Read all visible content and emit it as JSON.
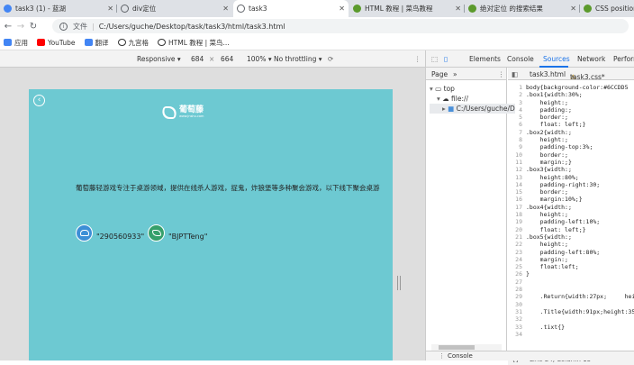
{
  "tabs": [
    {
      "title": "task3 (1) - 蓝湖",
      "color": "#4285f4"
    },
    {
      "title": "div定位",
      "color": "#5f6368"
    },
    {
      "title": "task3",
      "color": "#5f6368"
    },
    {
      "title": "HTML 教程 | 菜鸟教程",
      "color": "#5b9a2c"
    },
    {
      "title": "绝对定位 的搜索结果",
      "color": "#5b9a2c"
    },
    {
      "title": "CSS position",
      "color": "#5b9a2c"
    }
  ],
  "address": {
    "label": "文件",
    "url": "C:/Users/guche/Desktop/task/task3/html/task3.html"
  },
  "bookmarks": [
    {
      "label": "应用",
      "color": "#4285f4"
    },
    {
      "label": "YouTube",
      "color": "#ff0000"
    },
    {
      "label": "翻译",
      "color": "#4285f4"
    },
    {
      "label": "九宫格",
      "color": "#333333"
    },
    {
      "label": "HTML 教程 | 菜鸟...",
      "color": "#5b9a2c"
    }
  ],
  "device_toolbar": {
    "device": "Responsive ▾",
    "width": "684",
    "times": "×",
    "height": "664",
    "zoom": "100% ▾",
    "throttle": "No throttling ▾"
  },
  "page": {
    "logo_name": "葡萄藤",
    "logo_sub": "www.jnshu.com",
    "intro": "葡萄藤轻游戏专注于桌游领域，提供在线杀人游戏，捉鬼，炸狼堡等多种聚会游戏，以下线下聚会桌游",
    "qq_value": "\"290560933\"",
    "wechat_value": "\"BJPTTeng\""
  },
  "devtools": {
    "tabs": [
      "Elements",
      "Console",
      "Sources",
      "Network",
      "Perform"
    ],
    "active_tab": "Sources",
    "nav_tab": "Page",
    "nav_more": "»",
    "tree": [
      "top",
      "file://",
      "C:/Users/guche/D"
    ],
    "files": [
      "task3.html",
      "task3.css*"
    ],
    "status": "Line 24, Column 13",
    "console": "Console"
  },
  "code_lines": [
    [
      "1",
      "body{background-color:#6CCDD5"
    ],
    [
      "2",
      ".box1{width:30%;"
    ],
    [
      "3",
      "    height:;"
    ],
    [
      "4",
      "    padding:;"
    ],
    [
      "5",
      "    border:;"
    ],
    [
      "6",
      "    float: left;}"
    ],
    [
      "7",
      ".box2{width:;"
    ],
    [
      "8",
      "    height:;"
    ],
    [
      "9",
      "    padding-top:3%;"
    ],
    [
      "10",
      "    border:;"
    ],
    [
      "11",
      "    margin:;}"
    ],
    [
      "12",
      ".box3{width:;"
    ],
    [
      "13",
      "    height:80%;"
    ],
    [
      "14",
      "    padding-right:30;"
    ],
    [
      "15",
      "    border:;"
    ],
    [
      "16",
      "    margin:10%;}"
    ],
    [
      "17",
      ".box4{width:;"
    ],
    [
      "18",
      "    height:;"
    ],
    [
      "19",
      "    padding-left:10%;"
    ],
    [
      "20",
      "    float: left;}"
    ],
    [
      "21",
      ".box5{width:;"
    ],
    [
      "22",
      "    height:;"
    ],
    [
      "23",
      "    padding-left:80%;"
    ],
    [
      "24",
      "    margin:;"
    ],
    [
      "25",
      "    float:left;"
    ],
    [
      "26",
      "}"
    ],
    [
      "27",
      ""
    ],
    [
      "28",
      ""
    ],
    [
      "29",
      "    .Return{width:27px;     hei"
    ],
    [
      "30",
      ""
    ],
    [
      "31",
      "    .Title{width:91px;height:35"
    ],
    [
      "32",
      ""
    ],
    [
      "33",
      "    .tixt{}"
    ],
    [
      "34",
      ""
    ]
  ]
}
